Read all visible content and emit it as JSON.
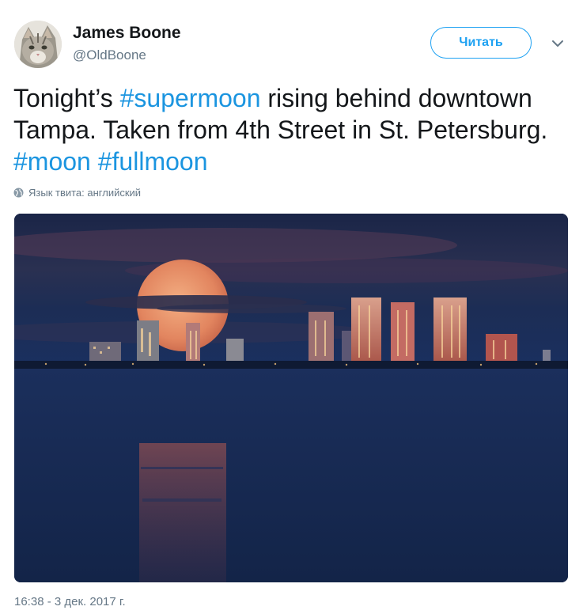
{
  "user": {
    "name": "James Boone",
    "handle": "@OldBoone"
  },
  "follow_button": {
    "label": "Читать"
  },
  "tweet": {
    "t1": "Tonight’s ",
    "h1": "#supermoon",
    "t2": " rising behind downtown Tampa. Taken from 4th Street in St. Petersburg. ",
    "h2": "#moon",
    "t3": " ",
    "h3": "#fullmoon"
  },
  "language_note": "Язык твита: английский",
  "timestamp": "16:38 - 3 дек. 2017 г.",
  "icons": {
    "avatar": "cat-avatar",
    "menu": "chevron-down-icon",
    "language": "globe-icon"
  },
  "colors": {
    "accent": "#1da1f2",
    "hashtag": "#1b95e0",
    "muted": "#657786"
  }
}
